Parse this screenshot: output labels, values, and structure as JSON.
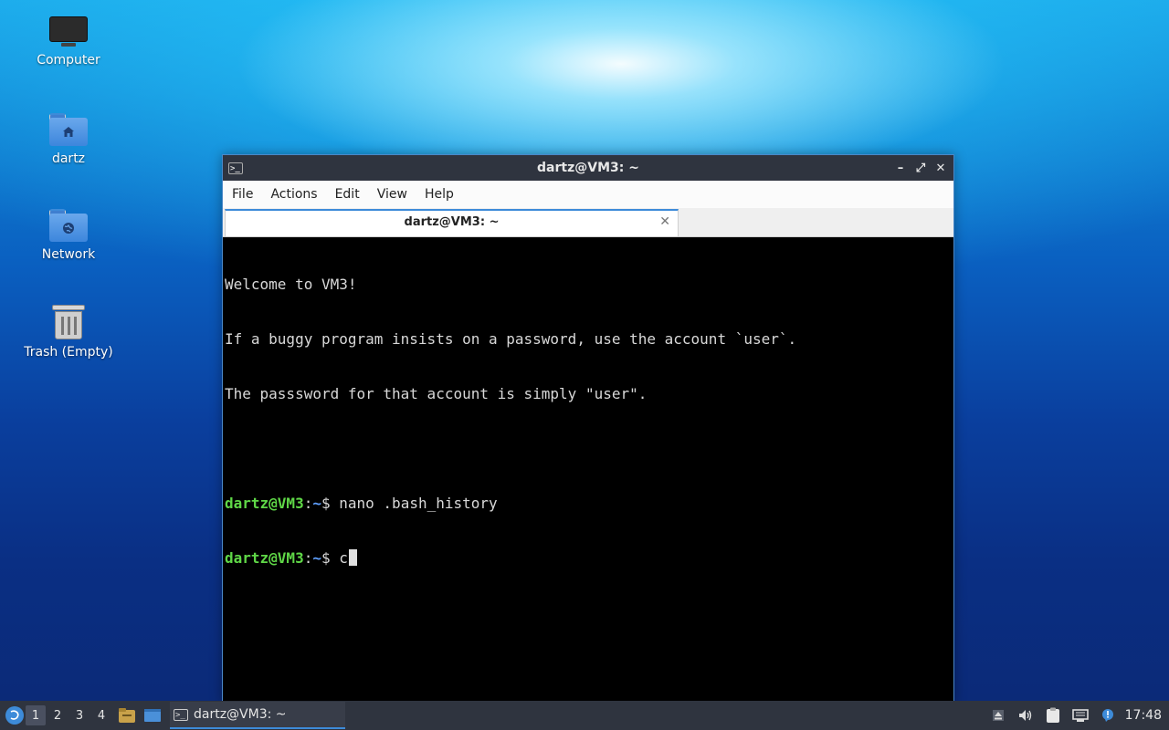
{
  "desktop": {
    "icons": [
      {
        "label": "Computer",
        "icon": "computer-icon"
      },
      {
        "label": "dartz",
        "icon": "home-folder-icon"
      },
      {
        "label": "Network",
        "icon": "network-folder-icon"
      },
      {
        "label": "Trash (Empty)",
        "icon": "trash-icon"
      }
    ]
  },
  "window": {
    "title": "dartz@VM3: ~",
    "controls": {
      "minimize": "–",
      "maximize": "⤢",
      "close": "✕"
    },
    "menu": [
      "File",
      "Actions",
      "Edit",
      "View",
      "Help"
    ],
    "tab": {
      "label": "dartz@VM3: ~",
      "close": "✕"
    },
    "terminal": {
      "lines": [
        "Welcome to VM3!",
        "If a buggy program insists on a password, use the account `user`.",
        "The passsword for that account is simply \"user\".",
        ""
      ],
      "prompts": [
        {
          "user": "dartz@VM3",
          "sep": ":",
          "path": "~",
          "symbol": "$",
          "command": " nano .bash_history"
        },
        {
          "user": "dartz@VM3",
          "sep": ":",
          "path": "~",
          "symbol": "$",
          "command": " c"
        }
      ]
    }
  },
  "taskbar": {
    "workspaces": [
      "1",
      "2",
      "3",
      "4"
    ],
    "active_workspace": "1",
    "task_label": "dartz@VM3: ~",
    "tray_icons": [
      "eject-icon",
      "volume-icon",
      "clipboard-icon",
      "network-icon",
      "notification-icon"
    ],
    "clock": "17:48"
  },
  "colors": {
    "accent": "#3d8bd9",
    "prompt_user": "#5fd747",
    "prompt_path": "#5fa0ff",
    "panel": "#2f343f"
  }
}
